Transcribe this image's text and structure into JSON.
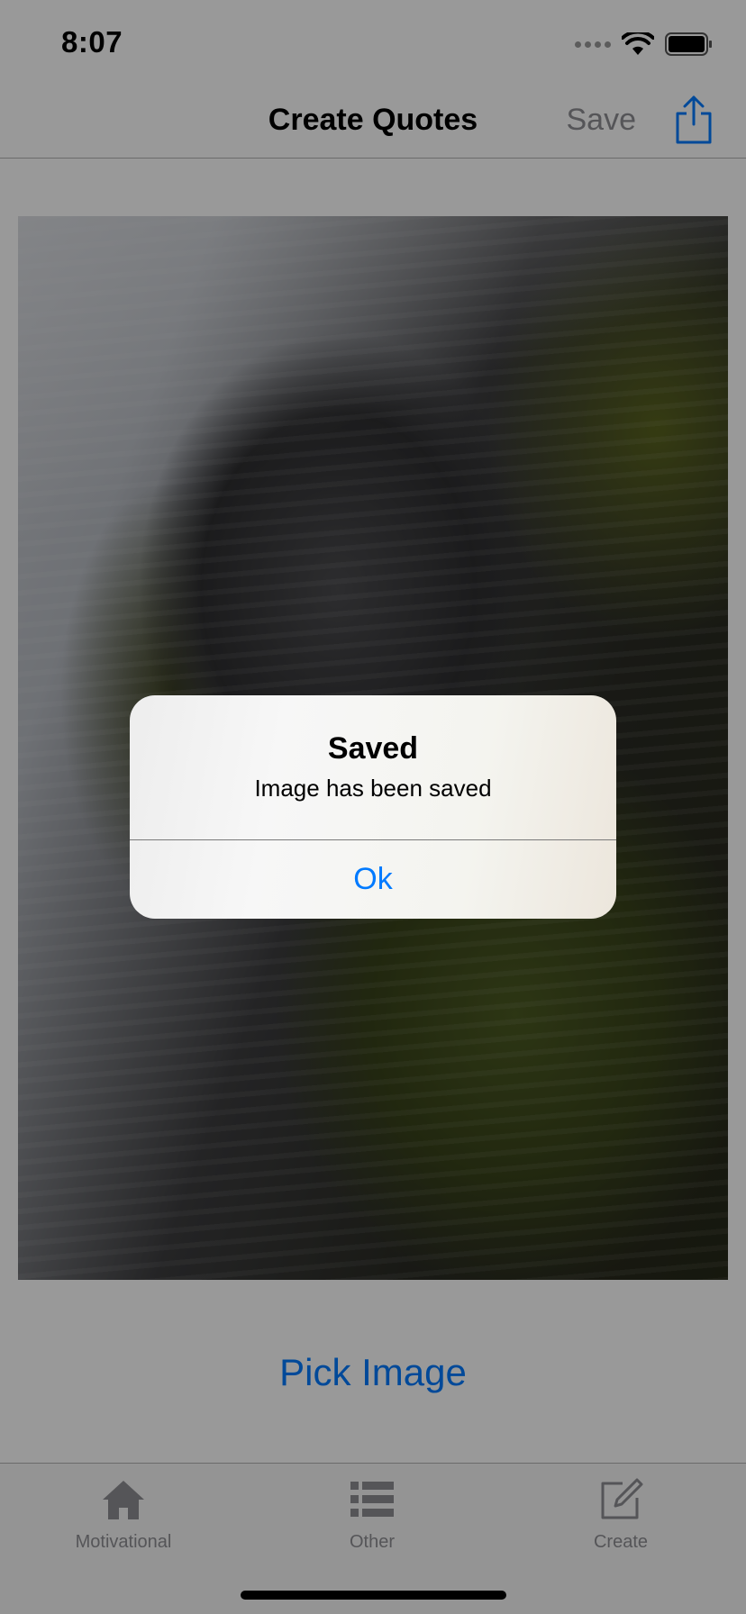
{
  "status_bar": {
    "time": "8:07"
  },
  "nav_bar": {
    "title": "Create Quotes",
    "save_label": "Save"
  },
  "main": {
    "pick_image_label": "Pick Image"
  },
  "tab_bar": {
    "items": [
      {
        "label": "Motivational",
        "icon": "house-icon"
      },
      {
        "label": "Other",
        "icon": "list-icon"
      },
      {
        "label": "Create",
        "icon": "compose-icon"
      }
    ]
  },
  "alert": {
    "title": "Saved",
    "message": "Image has been saved",
    "ok_label": "Ok"
  },
  "colors": {
    "accent": "#007aff",
    "inactive": "#8e8e93",
    "dim_overlay": "rgba(0,0,0,0.4)"
  }
}
